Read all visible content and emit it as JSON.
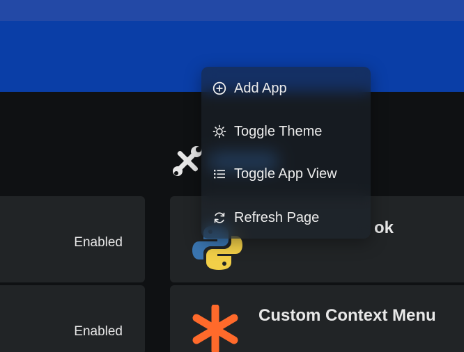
{
  "context_menu": {
    "items": [
      {
        "label": "Add App",
        "icon": "plus-circle-icon"
      },
      {
        "label": "Toggle Theme",
        "icon": "sun-icon"
      },
      {
        "label": "Toggle App View",
        "icon": "list-icon"
      },
      {
        "label": "Refresh Page",
        "icon": "refresh-icon"
      }
    ]
  },
  "section": {
    "icon": "tools-icon"
  },
  "left_cards": [
    {
      "status": "Enabled"
    },
    {
      "status": "Enabled"
    }
  ],
  "right_cards": [
    {
      "title": "ok",
      "icon": "python-logo-icon"
    },
    {
      "title": "Custom Context Menu",
      "icon": "asterisk-icon"
    }
  ],
  "colors": {
    "header": "#0a3ea7",
    "background": "#0f1113",
    "card": "#212426",
    "accent_orange": "#ff6a2b",
    "python_blue": "#3a75b0",
    "python_yellow": "#f2cf48"
  }
}
